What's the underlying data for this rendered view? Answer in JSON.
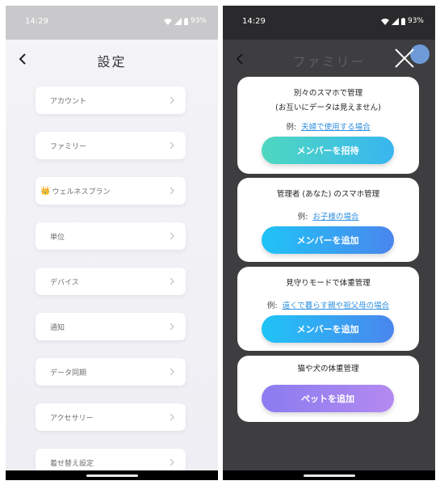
{
  "left": {
    "status": {
      "time": "14:29",
      "battery": "93%"
    },
    "title": "設定",
    "items": [
      {
        "label": "アカウント"
      },
      {
        "label": "ファミリー"
      },
      {
        "label": "ウェルネスプラン",
        "icon": "crown-icon"
      },
      {
        "label": "単位"
      },
      {
        "label": "デバイス"
      },
      {
        "label": "通知"
      },
      {
        "label": "データ同期"
      },
      {
        "label": "アクセサリー"
      },
      {
        "label": "着せ替え設定"
      }
    ]
  },
  "right": {
    "status": {
      "time": "14:29",
      "battery": "93%"
    },
    "title": "ファミリー",
    "cards": [
      {
        "title": "別々のスマホで管理",
        "subtitle": "(お互いにデータは見えません)",
        "example_label": "例:",
        "example_link": "夫婦で使用する場合",
        "button": "メンバーを招待"
      },
      {
        "title": "管理者 (あなた) のスマホ管理",
        "example_label": "例:",
        "example_link": "お子様の場合",
        "button": "メンバーを追加"
      },
      {
        "title": "見守りモードで体重管理",
        "example_label": "例:",
        "example_link": "遠くで暮らす親や祖父母の場合",
        "button": "メンバーを追加"
      },
      {
        "title": "猫や犬の体重管理",
        "button": "ペットを追加"
      }
    ]
  },
  "colors": {
    "invite_gradient": [
      "#4fd8c0",
      "#38b6f0"
    ],
    "add_gradient": [
      "#1fc4f6",
      "#4a86ee"
    ],
    "pet_gradient": [
      "#8a7cf0",
      "#b48af0"
    ],
    "link": "#2f8fe0",
    "crown": "#e8b41a"
  }
}
